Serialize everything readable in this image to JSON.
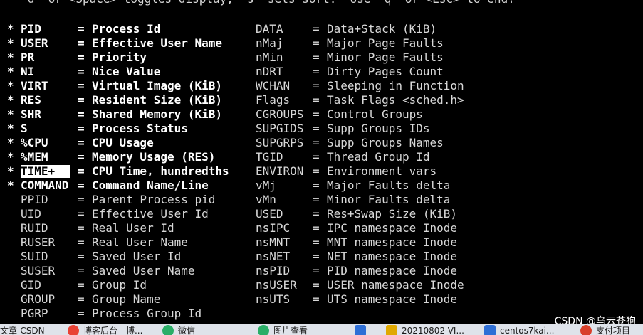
{
  "header": {
    "help_line": "  'd' or <Space> toggles display, 's' sets sort.  Use 'q' or <Esc> to end!"
  },
  "fields": [
    {
      "marker": "*",
      "name": "PID",
      "desc": "Process Id",
      "right_name": "DATA",
      "right_desc": "Data+Stack (KiB)"
    },
    {
      "marker": "*",
      "name": "USER",
      "desc": "Effective User Name",
      "right_name": "nMaj",
      "right_desc": "Major Page Faults"
    },
    {
      "marker": "*",
      "name": "PR",
      "desc": "Priority",
      "right_name": "nMin",
      "right_desc": "Minor Page Faults"
    },
    {
      "marker": "*",
      "name": "NI",
      "desc": "Nice Value",
      "right_name": "nDRT",
      "right_desc": "Dirty Pages Count"
    },
    {
      "marker": "*",
      "name": "VIRT",
      "desc": "Virtual Image (KiB)",
      "right_name": "WCHAN",
      "right_desc": "Sleeping in Function"
    },
    {
      "marker": "*",
      "name": "RES",
      "desc": "Resident Size (KiB)",
      "right_name": "Flags",
      "right_desc": "Task Flags <sched.h>"
    },
    {
      "marker": "*",
      "name": "SHR",
      "desc": "Shared Memory (KiB)",
      "right_name": "CGROUPS",
      "right_desc": "Control Groups"
    },
    {
      "marker": "*",
      "name": "S",
      "desc": "Process Status",
      "right_name": "SUPGIDS",
      "right_desc": "Supp Groups IDs"
    },
    {
      "marker": "*",
      "name": "%CPU",
      "desc": "CPU Usage",
      "right_name": "SUPGRPS",
      "right_desc": "Supp Groups Names"
    },
    {
      "marker": "*",
      "name": "%MEM",
      "desc": "Memory Usage (RES)",
      "right_name": "TGID",
      "right_desc": "Thread Group Id"
    },
    {
      "marker": "*",
      "name": "TIME+",
      "desc": "CPU Time, hundredths",
      "right_name": "ENVIRON",
      "right_desc": "Environment vars"
    },
    {
      "marker": "*",
      "name": "COMMAND",
      "desc": "Command Name/Line",
      "right_name": "vMj",
      "right_desc": "Major Faults delta"
    },
    {
      "marker": "",
      "name": "PPID",
      "desc": "Parent Process pid",
      "right_name": "vMn",
      "right_desc": "Minor Faults delta"
    },
    {
      "marker": "",
      "name": "UID",
      "desc": "Effective User Id",
      "right_name": "USED",
      "right_desc": "Res+Swap Size (KiB)"
    },
    {
      "marker": "",
      "name": "RUID",
      "desc": "Real User Id",
      "right_name": "nsIPC",
      "right_desc": "IPC namespace Inode"
    },
    {
      "marker": "",
      "name": "RUSER",
      "desc": "Real User Name",
      "right_name": "nsMNT",
      "right_desc": "MNT namespace Inode"
    },
    {
      "marker": "",
      "name": "SUID",
      "desc": "Saved User Id",
      "right_name": "nsNET",
      "right_desc": "NET namespace Inode"
    },
    {
      "marker": "",
      "name": "SUSER",
      "desc": "Saved User Name",
      "right_name": "nsPID",
      "right_desc": "PID namespace Inode"
    },
    {
      "marker": "",
      "name": "GID",
      "desc": "Group Id",
      "right_name": "nsUSER",
      "right_desc": "USER namespace Inode"
    },
    {
      "marker": "",
      "name": "GROUP",
      "desc": "Group Name",
      "right_name": "nsUTS",
      "right_desc": "UTS namespace Inode"
    },
    {
      "marker": "",
      "name": "PGRP",
      "desc": "Process Group Id",
      "right_name": "",
      "right_desc": ""
    }
  ],
  "equals": "=",
  "cursor_field": "TIME+",
  "watermark": "CSDN @乌云苍狗",
  "taskbar": {
    "items": [
      {
        "label": "文章-CSDN",
        "icon": "",
        "color": ""
      },
      {
        "label": "博客后台 - 博...",
        "icon": "chrome-icon",
        "color": "#e94235"
      },
      {
        "label": "微信",
        "icon": "wechat-icon",
        "color": "#2aae67"
      },
      {
        "label": "图片查看",
        "icon": "wechat-photo-icon",
        "color": "#2aae67"
      },
      {
        "label": "",
        "icon": "mail-icon",
        "color": "#2f6fd6"
      },
      {
        "label": "20210802-VI...",
        "icon": "doc-icon",
        "color": "#e0a800"
      },
      {
        "label": "centos7kai...",
        "icon": "terminal-icon",
        "color": "#2f6fd6"
      },
      {
        "label": "支付项目",
        "icon": "app-icon",
        "color": "#d9402b"
      }
    ]
  }
}
